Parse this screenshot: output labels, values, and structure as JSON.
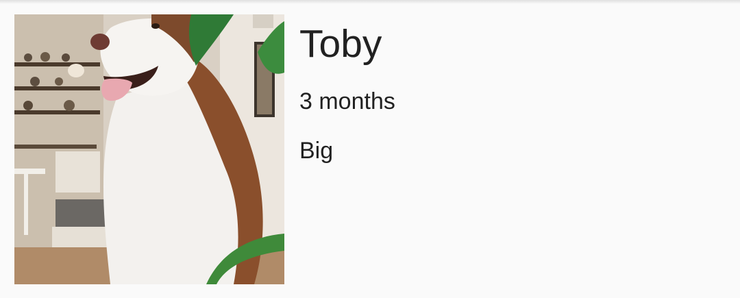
{
  "pet": {
    "name": "Toby",
    "age": "3 months",
    "size": "Big",
    "photo_subject": "dog-photo"
  }
}
